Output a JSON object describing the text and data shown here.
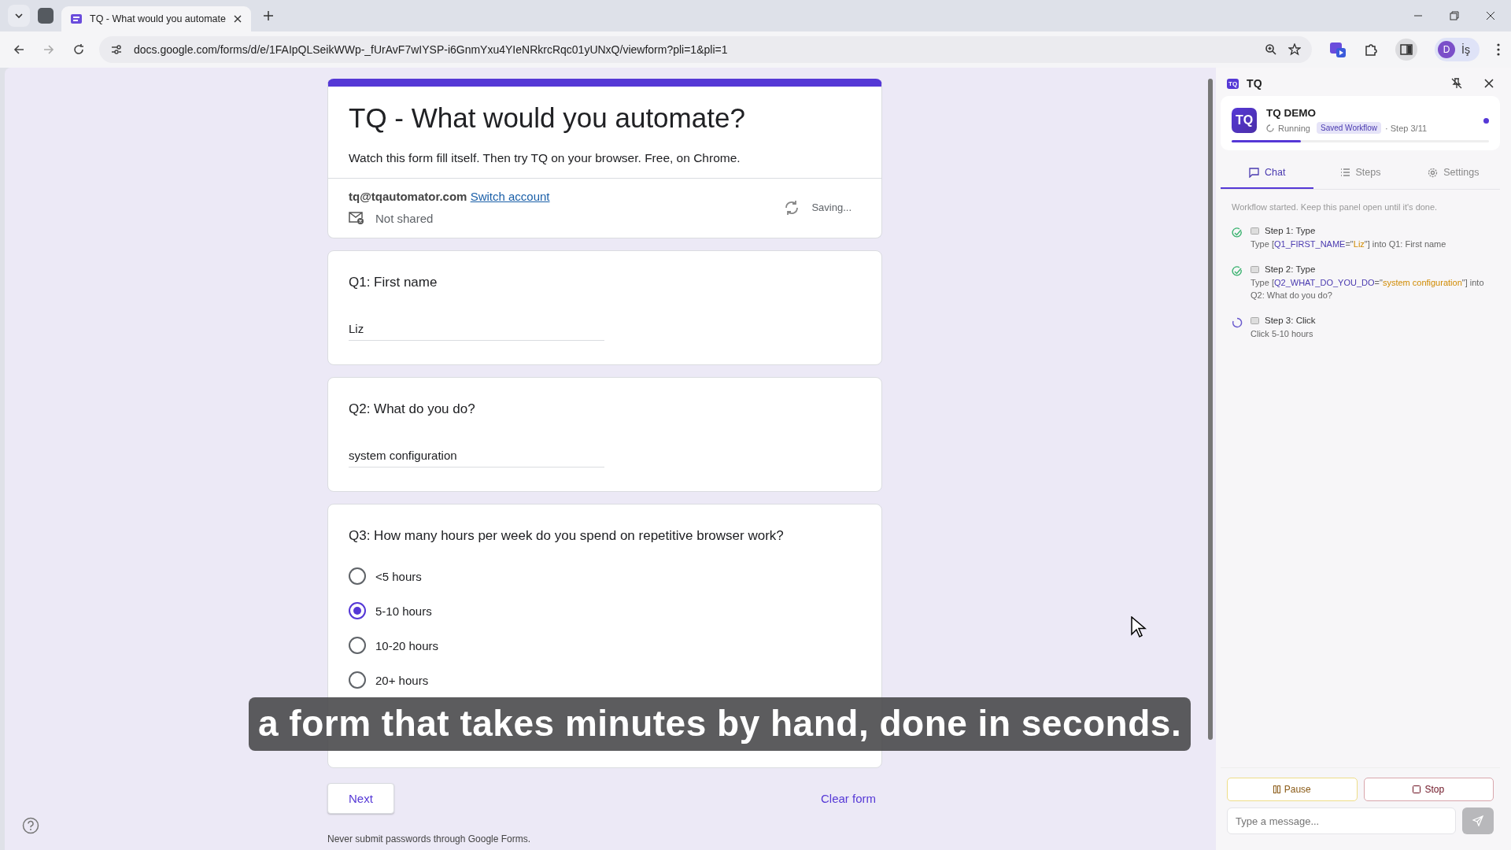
{
  "browser": {
    "tabs": [
      {
        "title": "TQ - What would you automate",
        "selected": true
      }
    ],
    "url": "docs.google.com/forms/d/e/1FAIpQLSeikWWp-_fUrAvF7wIYSP-i6GnmYxu4YIeNRkrcRqc01yUNxQ/viewform?pli=1&pli=1",
    "profile": {
      "initial": "D",
      "label": "İş"
    }
  },
  "form": {
    "title": "TQ - What would you automate?",
    "description": "Watch this form fill itself. Then try TQ on your browser. Free, on Chrome.",
    "email": "tq@tqautomator.com",
    "switch_link": "Switch account",
    "share_status": "Not shared",
    "saving": "Saving...",
    "questions": [
      {
        "kind": "text",
        "title": "Q1: First name",
        "value": "Liz"
      },
      {
        "kind": "text",
        "title": "Q2: What do you do?",
        "value": "system configuration"
      },
      {
        "kind": "radio",
        "title": "Q3: How many hours per week do you spend on repetitive browser work?",
        "options": [
          {
            "label": "<5 hours",
            "selected": false
          },
          {
            "label": "5-10 hours",
            "selected": true
          },
          {
            "label": "10-20 hours",
            "selected": false
          },
          {
            "label": "20+ hours",
            "selected": false
          }
        ]
      }
    ],
    "next": "Next",
    "clear": "Clear form",
    "note": "Never submit passwords through Google Forms."
  },
  "subtitle": "a form that takes minutes by hand, done in seconds.",
  "panel": {
    "header_logo": "TQ",
    "title": "TQ",
    "logo": "TQ",
    "workflow": "TQ DEMO",
    "status": "Running",
    "badge": "Saved Workflow",
    "step": "· Step 3/11",
    "progress": {
      "level": 0.27
    },
    "tabs": [
      {
        "label": "Chat",
        "selected": true
      },
      {
        "label": "Steps",
        "selected": false
      },
      {
        "label": "Settings",
        "selected": false
      }
    ],
    "intro": "Workflow started. Keep this panel open until it's done.",
    "steps": [
      {
        "title": "Step 1: Type",
        "completed": true,
        "detail": [
          {
            "kind": "plain",
            "text": "Type ["
          },
          {
            "kind": "variable",
            "text": "Q1_FIRST_NAME"
          },
          {
            "kind": "plain",
            "text": "=\""
          },
          {
            "kind": "value",
            "text": "Liz"
          },
          {
            "kind": "plain",
            "text": "\"] into Q1: First name"
          }
        ]
      },
      {
        "title": "Step 2: Type",
        "completed": true,
        "detail": [
          {
            "kind": "plain",
            "text": "Type ["
          },
          {
            "kind": "variable",
            "text": "Q2_WHAT_DO_YOU_DO"
          },
          {
            "kind": "plain",
            "text": "=\""
          },
          {
            "kind": "value",
            "text": "system configuration"
          },
          {
            "kind": "plain",
            "text": "\"] into Q2: What do you do?"
          }
        ]
      },
      {
        "title": "Step 3: Click",
        "completed": false,
        "detail": [
          {
            "kind": "plain",
            "text": "Click 5-10 hours"
          }
        ]
      }
    ],
    "pause": "Pause",
    "stop": "Stop",
    "message_placeholder": "Type a message..."
  }
}
